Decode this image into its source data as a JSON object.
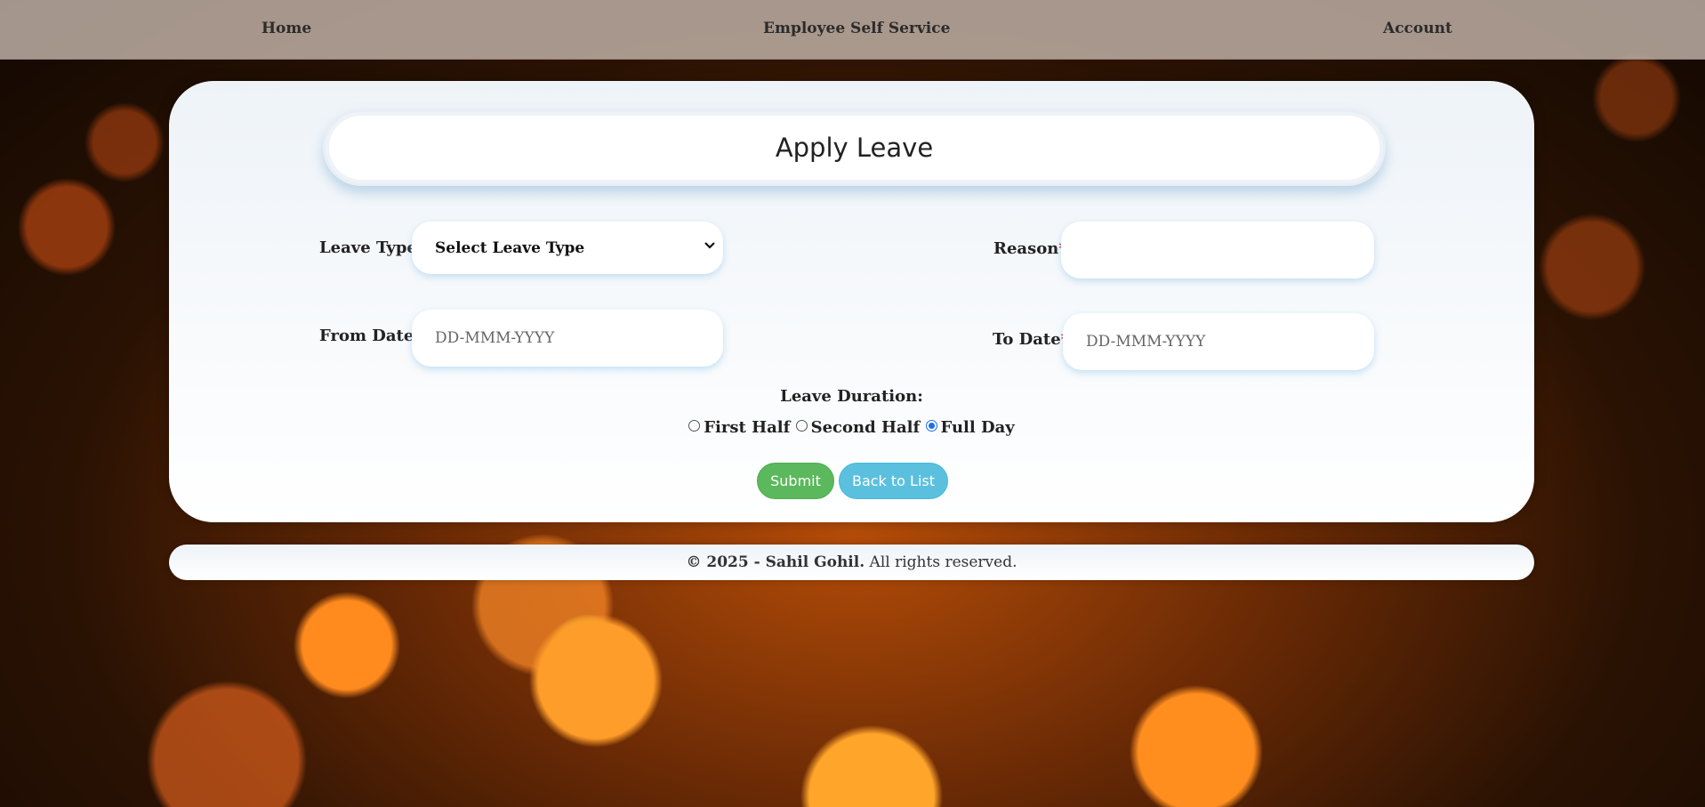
{
  "nav": {
    "home": "Home",
    "brand": "Employee Self Service",
    "account": "Account"
  },
  "form": {
    "title": "Apply Leave",
    "leave_type_label": "Leave Type:",
    "leave_type_value": "Select Leave Type",
    "reason_label": "Reason",
    "reason_value": "",
    "from_date_label": "From Date",
    "from_date_placeholder": "DD-MMM-YYYY",
    "to_date_label": "To Date",
    "to_date_placeholder": "DD-MMM-YYYY",
    "required_mark": "*",
    "duration_label": "Leave Duration:",
    "duration_options": [
      {
        "label": "First Half",
        "selected": false
      },
      {
        "label": "Second Half",
        "selected": false
      },
      {
        "label": "Full Day",
        "selected": true
      }
    ],
    "submit_label": "Submit",
    "back_label": "Back to List"
  },
  "footer": {
    "copyright": "© 2025 - Sahil Gohil.",
    "rights": "All rights reserved."
  },
  "colors": {
    "submit": "#5cb85c",
    "back": "#5bc0de",
    "required": "#e02020",
    "radio_selected": "#1f6fe5"
  }
}
